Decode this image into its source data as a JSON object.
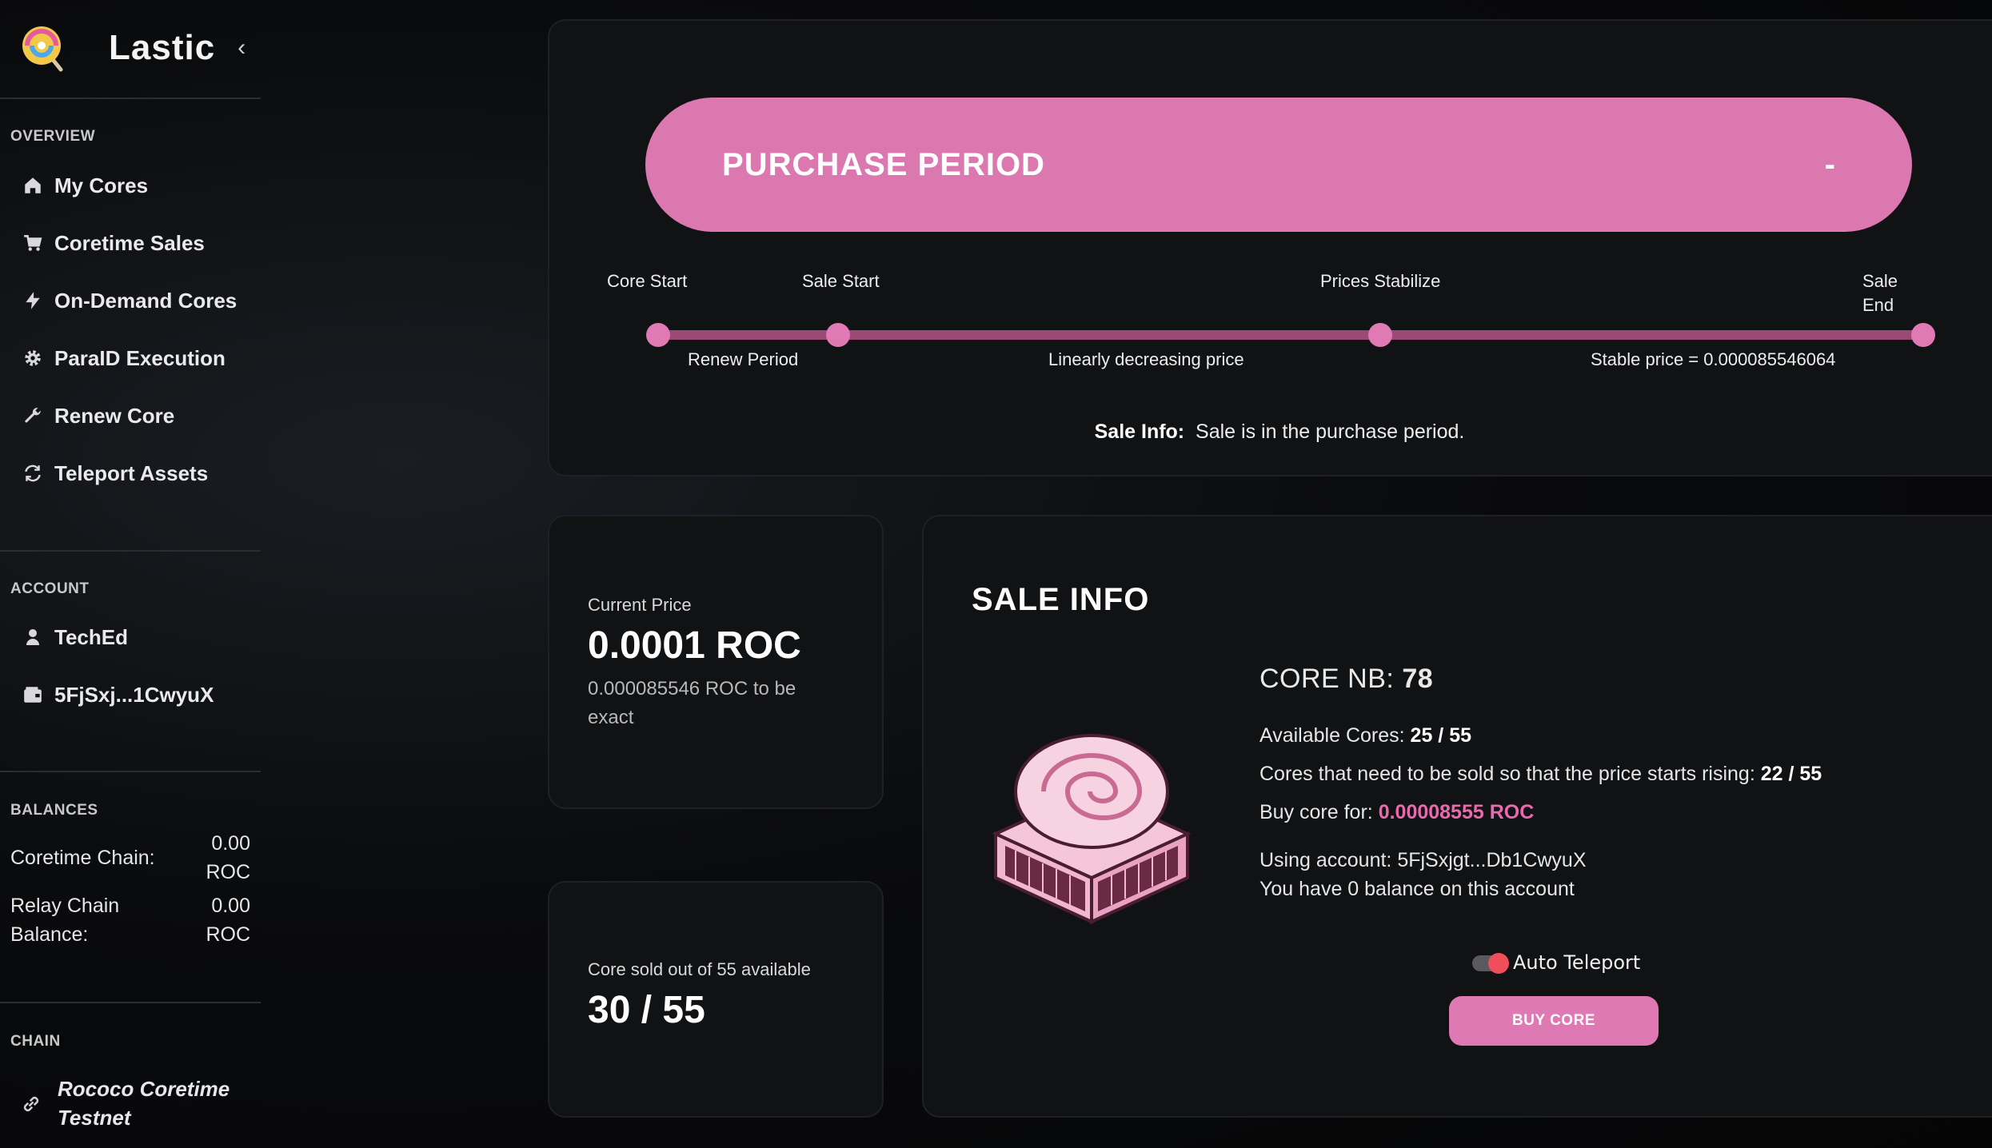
{
  "brand": {
    "name": "Lastic"
  },
  "sidebar": {
    "overview_title": "OVERVIEW",
    "items": [
      {
        "label": "My Cores",
        "icon": "home-icon"
      },
      {
        "label": "Coretime Sales",
        "icon": "cart-icon"
      },
      {
        "label": "On-Demand Cores",
        "icon": "bolt-icon"
      },
      {
        "label": "ParaID Execution",
        "icon": "gear-icon"
      },
      {
        "label": "Renew Core",
        "icon": "wrench-icon"
      },
      {
        "label": "Teleport Assets",
        "icon": "refresh-icon"
      }
    ],
    "account_title": "ACCOUNT",
    "account": {
      "name": "TechEd",
      "address": "5FjSxj...1CwyuX"
    },
    "balances_title": "BALANCES",
    "balances": {
      "coretime_label": "Coretime Chain:",
      "coretime_value": "0.00",
      "coretime_unit": "ROC",
      "relay_label_1": "Relay Chain",
      "relay_label_2": "Balance:",
      "relay_value": "0.00",
      "relay_unit": "ROC"
    },
    "chain_title": "CHAIN",
    "chain_name": "Rococo Coretime Testnet"
  },
  "period": {
    "title": "PURCHASE PERIOD",
    "remaining": "-",
    "milestones": {
      "core_start": "Core Start",
      "sale_start": "Sale Start",
      "prices_stabilize": "Prices Stabilize",
      "sale_end_1": "Sale",
      "sale_end_2": "End"
    },
    "phases": {
      "renew": "Renew Period",
      "linear": "Linearly decreasing price",
      "stable": "Stable price = 0.000085546064"
    },
    "sale_info_label": "Sale Info:",
    "sale_info_text": "Sale is in the purchase period."
  },
  "price_card": {
    "label": "Current Price",
    "value": "0.0001 ROC",
    "exact": "0.000085546 ROC to be exact"
  },
  "sold_card": {
    "label": "Core sold out of 55 available",
    "value": "30 / 55"
  },
  "sale_info": {
    "heading": "SALE INFO",
    "core_nb_label": "CORE NB:",
    "core_nb_value": "78",
    "available_label": "Available Cores:",
    "available_value": "25 / 55",
    "threshold_label": "Cores that need to be sold so that the price starts rising:",
    "threshold_value": "22 / 55",
    "buy_for_label": "Buy core for:",
    "buy_for_value": "0.00008555 ROC",
    "account_line": "Using account: 5FjSxjgt...Db1CwyuX",
    "balance_line": "You have 0 balance on this account",
    "auto_teleport_label": "Auto Teleport",
    "auto_teleport_on": true,
    "buy_button": "BUY CORE"
  },
  "colors": {
    "accent_pink": "#dc78b0",
    "timeline": "#9b4a76",
    "price_highlight": "#e86aae",
    "toggle_knob": "#ef4f5a"
  }
}
